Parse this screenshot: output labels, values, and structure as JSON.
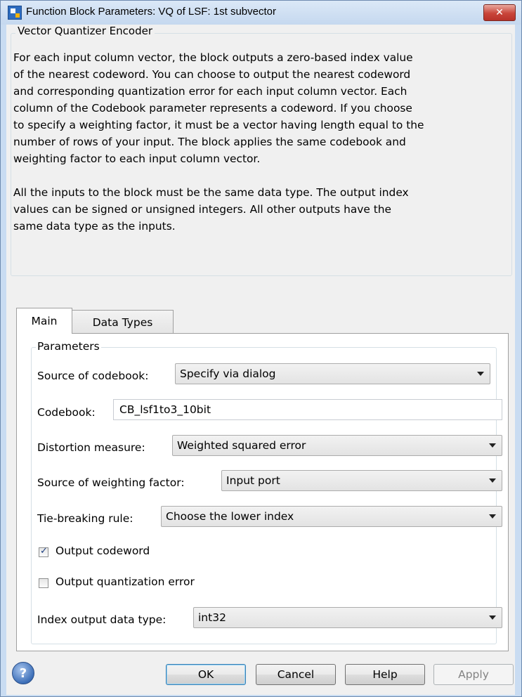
{
  "window": {
    "title": "Function Block Parameters: VQ of LSF: 1st subvector",
    "close_glyph": "✕"
  },
  "header_group": {
    "label": "Vector Quantizer Encoder",
    "description_lines": [
      "For each input column vector, the block outputs a zero-based index value",
      "of the nearest codeword. You can choose to output the nearest codeword",
      "and corresponding quantization error for each input column vector. Each",
      "column of the Codebook parameter represents a codeword. If you choose",
      "to specify a weighting factor, it must be a vector having length equal to the",
      "number of rows of your input. The block applies the same codebook and",
      "weighting factor to each input column vector.",
      "",
      "All the inputs to the block must be the same data type. The output index",
      "values can be signed or unsigned integers. All other outputs have the",
      "same data type as the inputs."
    ]
  },
  "tabs": [
    {
      "label": "Main",
      "active": true
    },
    {
      "label": "Data Types",
      "active": false
    }
  ],
  "parameters": {
    "group_label": "Parameters",
    "source_of_codebook": {
      "label": "Source of codebook:",
      "value": "Specify via dialog"
    },
    "codebook": {
      "label": "Codebook:",
      "value": "CB_lsf1to3_10bit"
    },
    "distortion_measure": {
      "label": "Distortion measure:",
      "value": "Weighted squared error"
    },
    "source_of_weighting": {
      "label": "Source of weighting factor:",
      "value": "Input port"
    },
    "tie_breaking": {
      "label": "Tie-breaking rule:",
      "value": "Choose the lower index"
    },
    "output_codeword": {
      "label": "Output codeword",
      "checked": true
    },
    "output_quant_error": {
      "label": "Output quantization error",
      "checked": false
    },
    "index_output_type": {
      "label": "Index output data type:",
      "value": "int32"
    }
  },
  "buttons": {
    "help_icon": "?",
    "ok": "OK",
    "cancel": "Cancel",
    "help": "Help",
    "apply": "Apply"
  }
}
